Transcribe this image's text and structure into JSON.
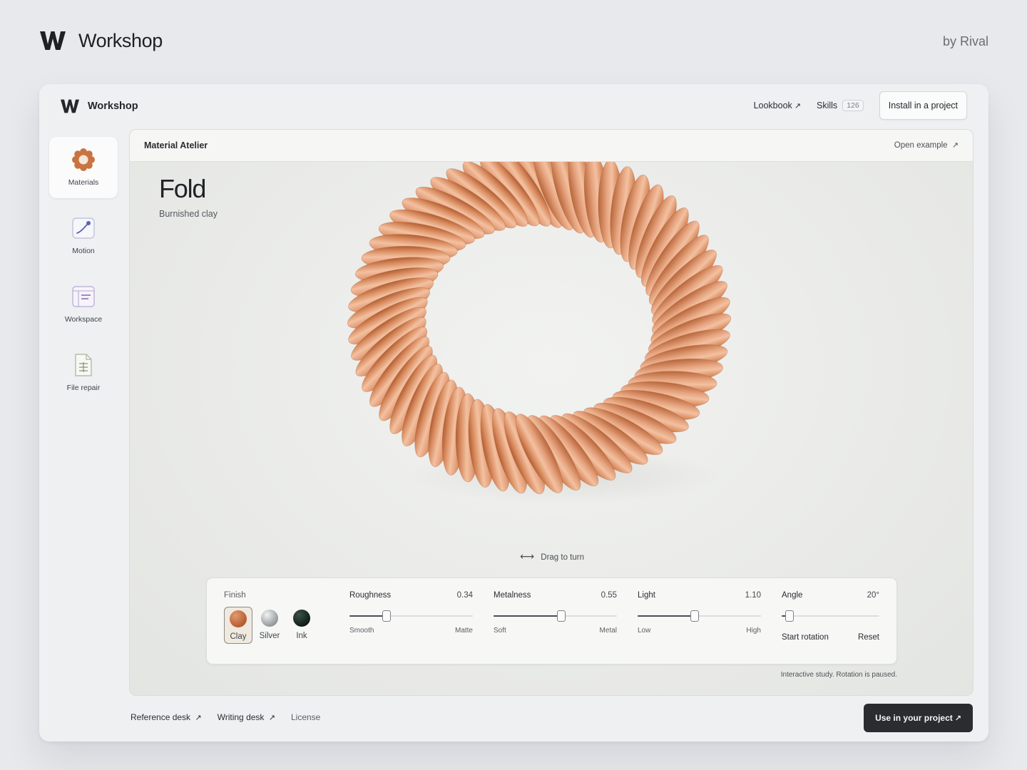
{
  "header": {
    "brand": "Workshop",
    "byline": "by Rival"
  },
  "app": {
    "title": "Workshop",
    "nav": {
      "lookbook": "Lookbook",
      "skills": "Skills",
      "skills_count": "126",
      "install": "Install in a project"
    }
  },
  "sidebar": {
    "items": [
      {
        "label": "Materials",
        "icon": "flower-gear-icon",
        "active": true
      },
      {
        "label": "Motion",
        "icon": "motion-curve-icon",
        "active": false
      },
      {
        "label": "Workspace",
        "icon": "workspace-window-icon",
        "active": false
      },
      {
        "label": "File repair",
        "icon": "document-icon",
        "active": false
      }
    ]
  },
  "panel": {
    "title": "Material Atelier",
    "open_example": "Open example",
    "material_name": "Fold",
    "material_subtitle": "Burnished clay",
    "drag_hint": "Drag to turn",
    "status_note": "Interactive study. Rotation is paused."
  },
  "controls": {
    "finish": {
      "label": "Finish",
      "options": [
        {
          "label": "Clay",
          "color": "#c06a3e",
          "selected": true
        },
        {
          "label": "Silver",
          "color": "#a9adb0",
          "selected": false
        },
        {
          "label": "Ink",
          "color": "#1f2d26",
          "selected": false
        }
      ]
    },
    "roughness": {
      "label": "Roughness",
      "value": "0.34",
      "fraction": 0.3,
      "min_label": "Smooth",
      "max_label": "Matte"
    },
    "metalness": {
      "label": "Metalness",
      "value": "0.55",
      "fraction": 0.55,
      "min_label": "Soft",
      "max_label": "Metal"
    },
    "light": {
      "label": "Light",
      "value": "1.10",
      "fraction": 0.46,
      "min_label": "Low",
      "max_label": "High"
    },
    "angle": {
      "label": "Angle",
      "value": "20°",
      "fraction": 0.08,
      "start_rotation": "Start rotation",
      "reset": "Reset"
    }
  },
  "footer": {
    "reference_desk": "Reference desk",
    "writing_desk": "Writing desk",
    "license": "License",
    "use_button": "Use in your project"
  },
  "colors": {
    "accent": "#2a2c30",
    "clay": "#d28c63",
    "background": "#e7e9ec"
  }
}
